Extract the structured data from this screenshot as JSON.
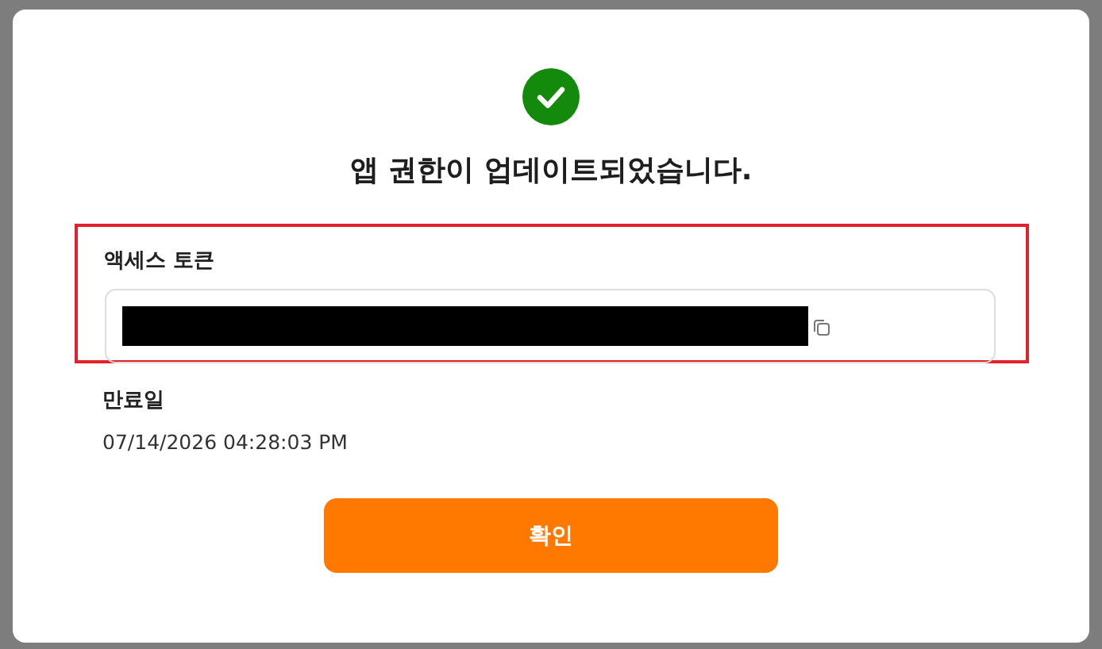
{
  "dialog": {
    "title": "앱 권한이 업데이트되었습니다.",
    "token_section": {
      "label": "액세스 토큰",
      "highlighted": true,
      "redacted": true
    },
    "expiry": {
      "label": "만료일",
      "value": "07/14/2026 04:28:03 PM"
    },
    "buttons": [
      {
        "label": "확인",
        "kind": "primary"
      }
    ]
  }
}
